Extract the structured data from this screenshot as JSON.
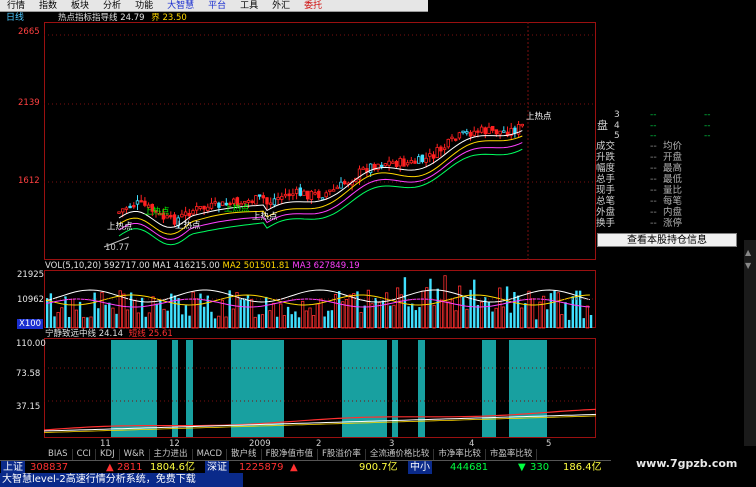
{
  "menu": [
    {
      "label": "行情",
      "style": ""
    },
    {
      "label": "指数",
      "style": ""
    },
    {
      "label": "板块",
      "style": ""
    },
    {
      "label": "分析",
      "style": ""
    },
    {
      "label": "功能",
      "style": ""
    },
    {
      "label": "大智慧",
      "style": "hl-blue"
    },
    {
      "label": "平台",
      "style": "hl-blue"
    },
    {
      "label": "工具",
      "style": ""
    },
    {
      "label": "外汇",
      "style": ""
    },
    {
      "label": "委托",
      "style": "hl-red"
    }
  ],
  "period_label": "日线",
  "main_indicator": {
    "title": "热点指标指导线",
    "value": "24.79",
    "extra": "界 23.50"
  },
  "price_axis": [
    "2665",
    "2139",
    "1612"
  ],
  "low_label": "10.77",
  "markers": [
    "上热点",
    "上热点",
    "上热点",
    "上热点",
    "上热点",
    "上热点"
  ],
  "volume_header": {
    "name": "VOL(5,10,20)",
    "v1": "592717.00",
    "ma1": "MA1 416215.00",
    "ma2": "MA2 501501.81",
    "ma3": "MA3 627849.19"
  },
  "volume_axis": [
    "21925",
    "10962",
    "X100"
  ],
  "osc_header": {
    "name": "宁静致远中线",
    "value": "24.14",
    "extra": "短线 25.61"
  },
  "osc_axis": [
    "110.00",
    "73.58",
    "37.15"
  ],
  "x_ticks": [
    "11",
    "12",
    "2009",
    "2",
    "3",
    "4",
    "5"
  ],
  "tabs": [
    "BIAS",
    "CCI",
    "KDJ",
    "W&R",
    "主力进出",
    "MACD",
    "散户线",
    "F股净值市值",
    "F股溢价率",
    "全流通价格比较",
    "市净率比较",
    "市盈率比较"
  ],
  "right_panel": {
    "partial_rows": [
      "3",
      "4",
      "5"
    ],
    "partial_label": "盘",
    "rows": [
      {
        "k": "成交",
        "v": "均价"
      },
      {
        "k": "升跌",
        "v": "开盘"
      },
      {
        "k": "幅度",
        "v": "最高"
      },
      {
        "k": "总手",
        "v": "最低"
      },
      {
        "k": "现手",
        "v": "量比"
      },
      {
        "k": "总笔",
        "v": "每笔"
      },
      {
        "k": "外盘",
        "v": "内盘"
      },
      {
        "k": "换手",
        "v": "涨停"
      }
    ],
    "button": "查看本股持仓信息"
  },
  "ticker": {
    "sh_label": "上证",
    "sh_index": "308837",
    "sh_change": "2811",
    "sh_amount": "1804.6亿",
    "sz_label": "深证",
    "sz_index": "1225879",
    "sz_amount": "900.7亿",
    "sm_label": "中小",
    "sm_index": "444681",
    "sm_change": "330",
    "sm_amount": "186.4亿"
  },
  "status": "大智慧level-2高速行情分析系统，免费下载",
  "watermark": "www.7gpzb.com"
}
